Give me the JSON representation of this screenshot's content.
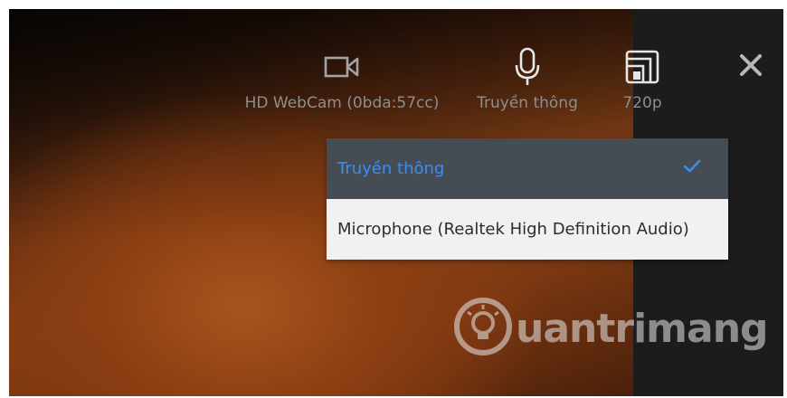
{
  "toolbar": {
    "camera": {
      "icon": "video-camera-icon",
      "label": "HD WebCam (0bda:57cc)"
    },
    "microphone": {
      "icon": "microphone-icon",
      "label": "Truyền thông"
    },
    "resolution": {
      "icon": "resolution-icon",
      "label": "720p"
    },
    "close": {
      "icon": "close-icon"
    }
  },
  "audio_dropdown": {
    "items": [
      {
        "label": "Truyền thông",
        "selected": true,
        "check_icon": "checkmark-icon"
      },
      {
        "label": "Microphone (Realtek High Definition Audio)",
        "selected": false
      }
    ]
  },
  "watermark": {
    "text": "uantrimang",
    "icon": "lightbulb-icon"
  },
  "colors": {
    "selected_text": "#3d8cf0",
    "selected_bg": "#464c54",
    "option_bg": "#f1f1f1",
    "icon_gray": "#9a9a9a"
  }
}
